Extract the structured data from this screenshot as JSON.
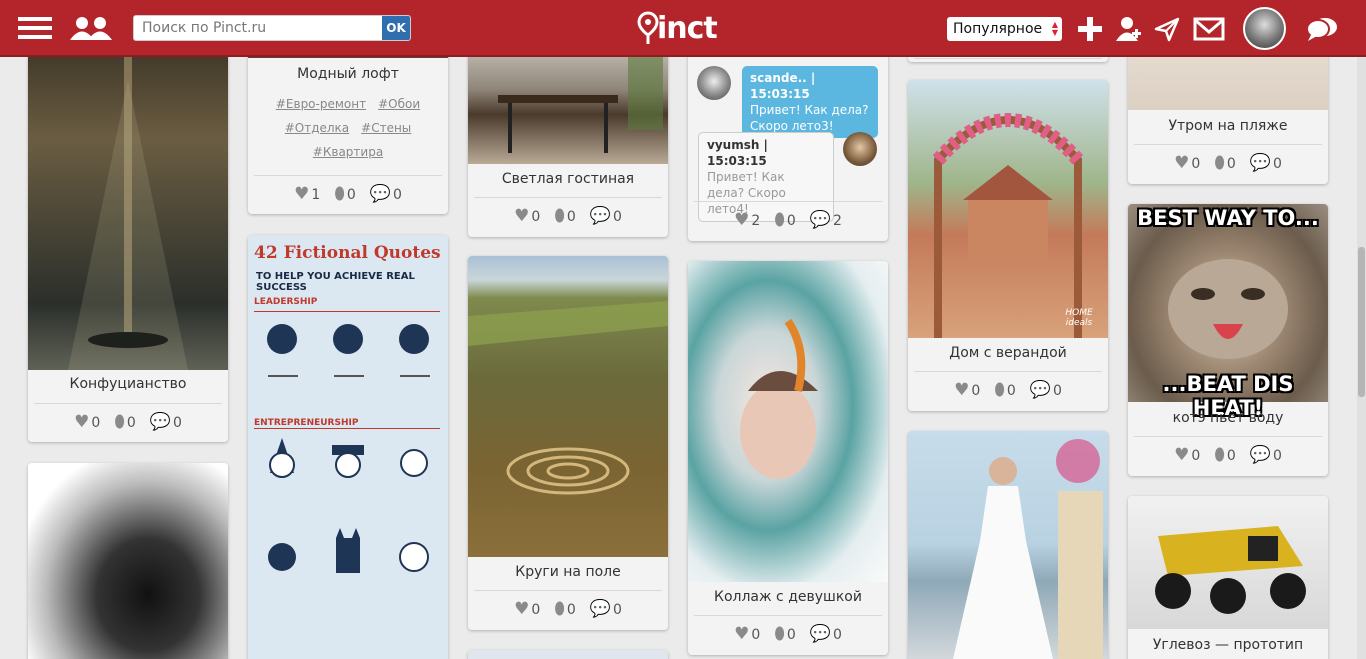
{
  "header": {
    "search_placeholder": "Поиск по Pinct.ru",
    "search_ok": "OK",
    "logo": "Pinct",
    "sort_selected": "Популярное"
  },
  "pins": [
    {
      "id": "konfuc",
      "caption": "Конфуцианство",
      "likes": "0",
      "pins": "0",
      "comments": "0"
    },
    {
      "id": "loft",
      "caption": "Модный лофт",
      "tags": [
        "#Евро-ремонт",
        "#Обои",
        "#Отделка",
        "#Стены",
        "#Квартира"
      ],
      "likes": "1",
      "pins": "0",
      "comments": "0"
    },
    {
      "id": "infographic",
      "title_top": "42 Fictional Quotes",
      "title_sub": "TO HELP YOU ACHIEVE REAL SUCCESS",
      "section1": "LEADERSHIP",
      "section2": "ENTREPRENEURSHIP"
    },
    {
      "id": "gostinaya",
      "caption": "Светлая гостиная",
      "likes": "0",
      "pins": "0",
      "comments": "0"
    },
    {
      "id": "krugi",
      "caption": "Круги на поле",
      "likes": "0",
      "pins": "0",
      "comments": "0"
    },
    {
      "id": "chat",
      "msg1_user": "scande.. | 15:03:15",
      "msg1_text": "Привет! Как дела? Скоро лето3!",
      "msg2_user": "vyumsh | 15:03:15",
      "msg2_text": "Привет! Как дела? Скоро лето4!",
      "likes": "2",
      "pins": "0",
      "comments": "2"
    },
    {
      "id": "kollazh",
      "caption": "Коллаж с девушкой",
      "likes": "0",
      "pins": "0",
      "comments": "0"
    },
    {
      "id": "dom",
      "caption": "Дом с верандой",
      "likes": "0",
      "pins": "0",
      "comments": "0",
      "watermark": "HOME ideals"
    },
    {
      "id": "plyazh",
      "caption": "Утром на пляже",
      "likes": "0",
      "pins": "0",
      "comments": "0"
    },
    {
      "id": "kote",
      "caption": "котэ пьёт воду",
      "meme_top": "BEST WAY TO...",
      "meme_bottom": "...BEAT DIS HEAT!",
      "likes": "0",
      "pins": "0",
      "comments": "0"
    },
    {
      "id": "uglevoz",
      "caption": "Углевоз — прототип"
    }
  ]
}
